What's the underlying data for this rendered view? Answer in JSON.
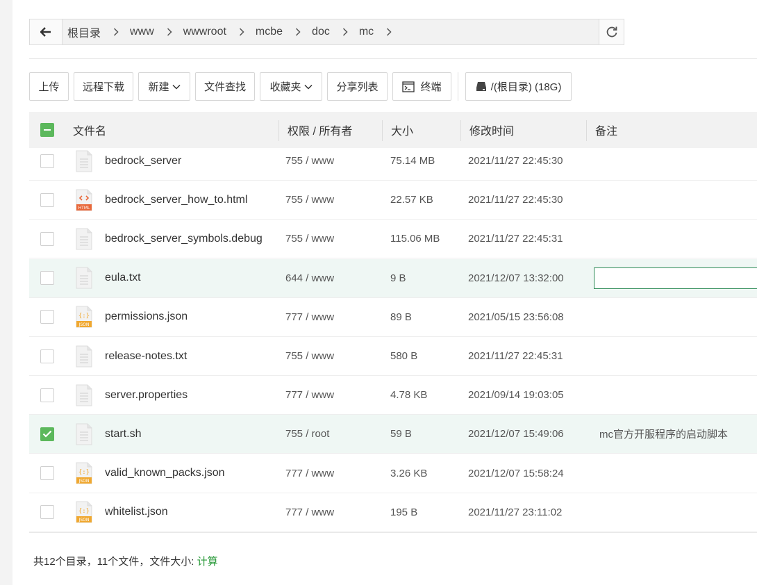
{
  "breadcrumb": {
    "items": [
      "根目录",
      "www",
      "wwwroot",
      "mcbe",
      "doc",
      "mc"
    ]
  },
  "toolbar": {
    "upload": "上传",
    "remote_download": "远程下载",
    "new": "新建",
    "file_search": "文件查找",
    "favorites": "收藏夹",
    "share_list": "分享列表",
    "terminal": "终端",
    "disk": "/(根目录) (18G)"
  },
  "table": {
    "headers": {
      "name": "文件名",
      "perm": "权限 / 所有者",
      "size": "大小",
      "mtime": "修改时间",
      "remark": "备注"
    },
    "rows": [
      {
        "name": "bedrock_server",
        "perm": "755 / www",
        "size": "75.14 MB",
        "mtime": "2021/11/27 22:45:30",
        "remark": "",
        "icon": "file",
        "checked": false
      },
      {
        "name": "bedrock_server_how_to.html",
        "perm": "755 / www",
        "size": "22.57 KB",
        "mtime": "2021/11/27 22:45:30",
        "remark": "",
        "icon": "html",
        "checked": false
      },
      {
        "name": "bedrock_server_symbols.debug",
        "perm": "755 / www",
        "size": "115.06 MB",
        "mtime": "2021/11/27 22:45:31",
        "remark": "",
        "icon": "file",
        "checked": false
      },
      {
        "name": "eula.txt",
        "perm": "644 / www",
        "size": "9 B",
        "mtime": "2021/12/07 13:32:00",
        "remark": "",
        "icon": "file",
        "checked": false,
        "editing": true
      },
      {
        "name": "permissions.json",
        "perm": "777 / www",
        "size": "89 B",
        "mtime": "2021/05/15 23:56:08",
        "remark": "",
        "icon": "json",
        "checked": false
      },
      {
        "name": "release-notes.txt",
        "perm": "755 / www",
        "size": "580 B",
        "mtime": "2021/11/27 22:45:31",
        "remark": "",
        "icon": "file",
        "checked": false
      },
      {
        "name": "server.properties",
        "perm": "777 / www",
        "size": "4.78 KB",
        "mtime": "2021/09/14 19:03:05",
        "remark": "",
        "icon": "file",
        "checked": false
      },
      {
        "name": "start.sh",
        "perm": "755 / root",
        "size": "59 B",
        "mtime": "2021/12/07 15:49:06",
        "remark": "mc官方开服程序的启动脚本",
        "icon": "file",
        "checked": true
      },
      {
        "name": "valid_known_packs.json",
        "perm": "777 / www",
        "size": "3.26 KB",
        "mtime": "2021/12/07 15:58:24",
        "remark": "",
        "icon": "json",
        "checked": false
      },
      {
        "name": "whitelist.json",
        "perm": "777 / www",
        "size": "195 B",
        "mtime": "2021/11/27 23:11:02",
        "remark": "",
        "icon": "json",
        "checked": false
      }
    ]
  },
  "footer": {
    "summary": "共12个目录，11个文件，文件大小: ",
    "calc": "计算"
  },
  "colors": {
    "accent_green": "#5cb85c",
    "link_green": "#2a9a3a",
    "html_icon": "#e8683a",
    "json_icon": "#f0a830"
  }
}
